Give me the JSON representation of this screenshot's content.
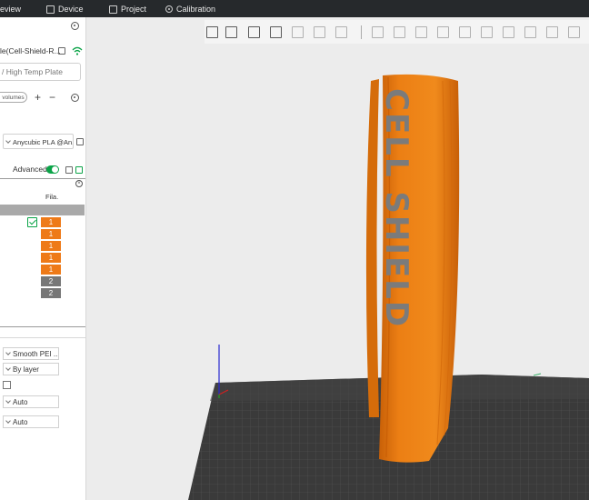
{
  "topbar": {
    "tabs": [
      {
        "label": "eview",
        "icon": "preview-icon"
      },
      {
        "label": "Device",
        "icon": "device-icon"
      },
      {
        "label": "Project",
        "icon": "project-icon"
      },
      {
        "label": "Calibration",
        "icon": "calibration-icon"
      }
    ]
  },
  "sidebar": {
    "printer_name": "le(Cell-Shield-R...",
    "plate_type": "/ High Temp Plate",
    "volumes_label": "volumes",
    "filament_preset": "Anycubic PLA @An...",
    "advanced_label": "Advanced",
    "objects_table": {
      "filament_header": "Fila.",
      "filaments": [
        "1",
        "1",
        "1",
        "1",
        "1",
        "2",
        "2"
      ]
    },
    "process": {
      "plate_surface": "Smooth PEI ...",
      "sequence": "By layer",
      "wall_generator": "Auto",
      "seam": "Auto"
    }
  },
  "viewport": {
    "model_text": "CELL SHIELD",
    "colors": {
      "model_orange": "#e87a12",
      "model_text_grey": "#7b7b7b",
      "bed": "#3a3a3a",
      "accent_green": "#0aa347"
    }
  }
}
